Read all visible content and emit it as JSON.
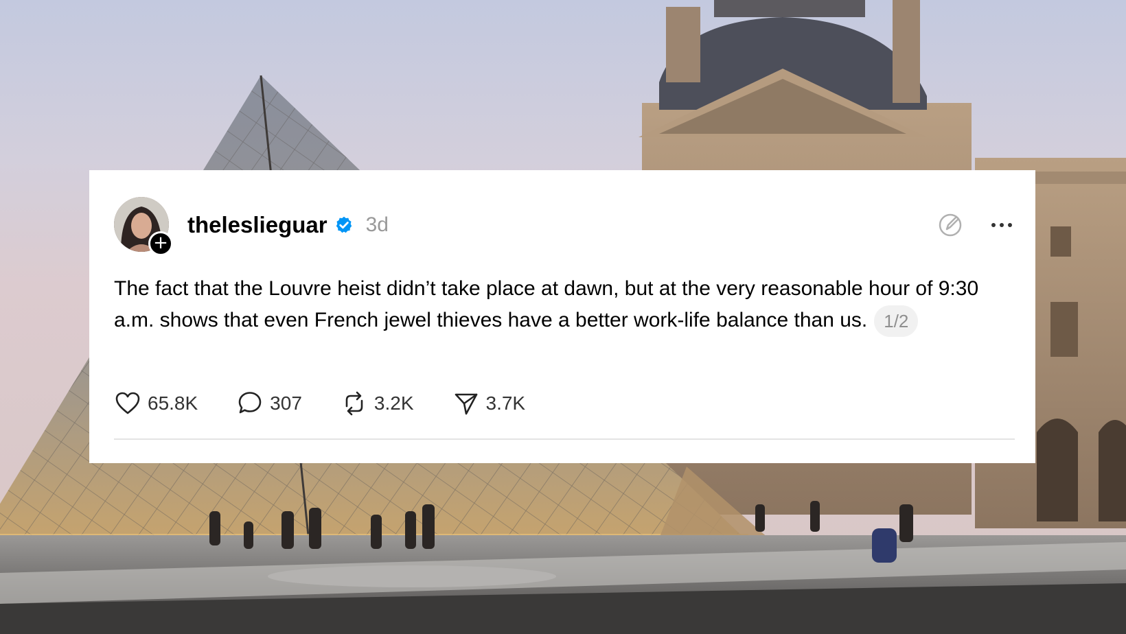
{
  "post": {
    "username": "theleslieguar",
    "timestamp": "3d",
    "text": "The fact that the Louvre heist didn’t take place at dawn, but at the very reasonable hour of 9:30 a.m. shows that even French jewel thieves have a better work-life balance than us.",
    "thread_indicator": "1/2",
    "follow_symbol": "+"
  },
  "actions": {
    "likes": "65.8K",
    "replies": "307",
    "reposts": "3.2K",
    "shares": "3.7K"
  },
  "icons": {
    "verified": "verified-badge-icon",
    "edit": "edit-circle-icon",
    "more": "more-dots-icon",
    "like": "heart-icon",
    "reply": "speech-bubble-icon",
    "repost": "repost-arrows-icon",
    "share": "paper-plane-icon"
  },
  "colors": {
    "verified_blue": "#0095f6",
    "timestamp_gray": "#999999",
    "pill_bg": "#f1f1f1"
  }
}
